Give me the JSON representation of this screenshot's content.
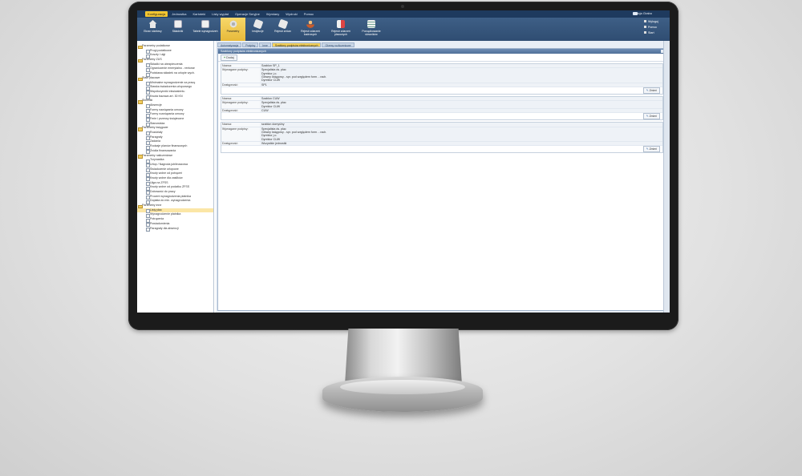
{
  "menu": {
    "items": [
      "Konfiguracja",
      "Jednostka",
      "Kartoteki",
      "Listy wypłat",
      "Operacje Seryjne",
      "Wymiany",
      "Wydruki",
      "Pomoc"
    ],
    "active_index": 0,
    "user": "Alicja Grabo"
  },
  "ribbon": {
    "buttons": [
      {
        "label": "Ekran startowy",
        "icon": "home-icon"
      },
      {
        "label": "Składniki",
        "icon": "document-icon"
      },
      {
        "label": "Tabele wynagrodzeń",
        "icon": "document-icon"
      },
      {
        "label": "Parametry",
        "icon": "gear-icon"
      },
      {
        "label": "Instytucje",
        "icon": "pen-icon"
      },
      {
        "label": "Rejestr zmian",
        "icon": "pen-icon"
      },
      {
        "label": "Rejestr zdarzeń kadrowych",
        "icon": "person-icon"
      },
      {
        "label": "Rejestr zdarzeń płacowych",
        "icon": "chart-icon"
      },
      {
        "label": "Porządkowanie słowników",
        "icon": "list-icon"
      }
    ],
    "active_index": 3,
    "side_links": [
      "Wyloguj",
      "Pomoc",
      "Start"
    ]
  },
  "tree": {
    "nodes": [
      {
        "label": "Parametry podatkowe",
        "type": "folder"
      },
      {
        "label": "Progi podatkowe",
        "type": "leaf"
      },
      {
        "label": "Koszty i ulgi",
        "type": "leaf"
      },
      {
        "label": "Parametry ZUS",
        "type": "folder"
      },
      {
        "label": "Składki na ubezpieczenia",
        "type": "leaf"
      },
      {
        "label": "Ograniczenie emerytalno - rentowe",
        "type": "leaf"
      },
      {
        "label": "Podstawa składek na urlopie wych.",
        "type": "leaf"
      },
      {
        "label": "Stałe płacowe",
        "type": "folder"
      },
      {
        "label": "Minimalne wynagrodzenie za pracę",
        "type": "leaf"
      },
      {
        "label": "Stawka świadczenia urlopowego",
        "type": "leaf"
      },
      {
        "label": "Współczynniki ekwiwalentu",
        "type": "leaf"
      },
      {
        "label": "Kwota bazowa art. 30 KN",
        "type": "leaf"
      },
      {
        "label": "Słowniki",
        "type": "folder"
      },
      {
        "label": "Absencje",
        "type": "leaf"
      },
      {
        "label": "Formy nawiązania umowy",
        "type": "leaf"
      },
      {
        "label": "Formy rozwiązania umowy",
        "type": "leaf"
      },
      {
        "label": "Ferie i przerwy świąteczne",
        "type": "leaf"
      },
      {
        "label": "Stanowiska",
        "type": "leaf"
      },
      {
        "label": "Parametry księgowe",
        "type": "folder"
      },
      {
        "label": "Rozdziały",
        "type": "leaf"
      },
      {
        "label": "Paragrafy",
        "type": "leaf"
      },
      {
        "label": "Zadania",
        "type": "leaf"
      },
      {
        "label": "Rodzaje planów finansowych",
        "type": "leaf"
      },
      {
        "label": "Źródła finansowania",
        "type": "leaf"
      },
      {
        "label": "Parametry naliczeniowe",
        "type": "folder"
      },
      {
        "label": "Trzynastka",
        "type": "leaf"
      },
      {
        "label": "Urlop / Nagroda jubileuszowa",
        "type": "leaf"
      },
      {
        "label": "Świadczenie urlopowe",
        "type": "leaf"
      },
      {
        "label": "Kwoty wolne od potrąceń",
        "type": "leaf"
      },
      {
        "label": "Kwoty wolne dla zasiłków",
        "type": "leaf"
      },
      {
        "label": "Ulga na ZFSS",
        "type": "leaf"
      },
      {
        "label": "Kwoty wolne od podatku ZFSS",
        "type": "leaf"
      },
      {
        "label": "Dobowość do pracy",
        "type": "leaf"
      },
      {
        "label": "Procent wynagrodzenia płatnika",
        "type": "leaf"
      },
      {
        "label": "Dopłata do min. wynagrodzenia",
        "type": "leaf"
      },
      {
        "label": "Parametry inne",
        "type": "folder"
      },
      {
        "label": "Listy płac",
        "type": "leaf",
        "selected": true
      },
      {
        "label": "Wynagrodzenie płatnika",
        "type": "leaf"
      },
      {
        "label": "Potrącenia",
        "type": "leaf"
      },
      {
        "label": "Powiadomienia",
        "type": "leaf"
      },
      {
        "label": "Paragrafy dla absencji",
        "type": "leaf"
      }
    ]
  },
  "tabs": {
    "items": [
      "Automatyzacja",
      "Podpisy",
      "Inne",
      "Szablony podpisów elektronicznych",
      "Okresy rozliczeniowe"
    ],
    "active_index": 3
  },
  "panel": {
    "title": "Szablony podpisów elektronicznych",
    "add_label": "Dodaj",
    "edit_label": "Zmień",
    "labels": {
      "name": "Nazwa:",
      "required": "Wymagane podpisy:",
      "access": "Dostępność:"
    },
    "templates": [
      {
        "name": "Szablon SP_1",
        "signatures": [
          "Specjalista ds. płac",
          "Dyrektor j.o.",
          "Główny księgowy - spr. pod względem form. - rach.",
          "Dyrektor CUW"
        ],
        "access": "SP1"
      },
      {
        "name": "Szablon CUW",
        "signatures": [
          "Specjalista ds. płac",
          "Dyrektor CUW"
        ],
        "access": "CUW"
      },
      {
        "name": "szablon domyślny",
        "signatures": [
          "Specjalista ds. płac",
          "Główny księgowy - spr. pod względem form. - rach.",
          "Dyrektor j.o.",
          "Dyrektor CUW"
        ],
        "access": "Wszystkie jednostki"
      }
    ]
  },
  "colors": {
    "menubar": "#1e3a5e",
    "ribbon": "#3e5f86",
    "accent": "#f2c530",
    "selection": "#fbe6a6"
  }
}
